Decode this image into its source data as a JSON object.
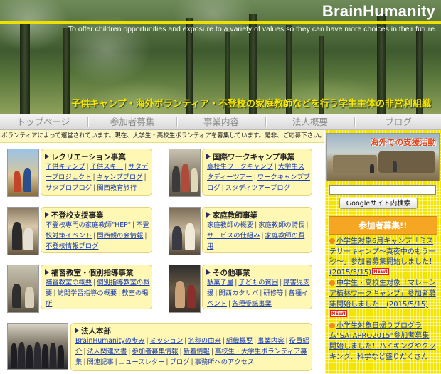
{
  "header": {
    "logo": "BrainHumanity",
    "tagline": "To offer children opportunities and exposure to a variety of values so they can have more choices in their future.",
    "headline": "子供キャンプ・海外ボランティア・不登校の家庭教師などを行う学生主体の非営利組織",
    "accent_color": "#f0e000"
  },
  "nav": [
    "トップページ",
    "参加者募集",
    "事業内容",
    "法人概要",
    "ブログ"
  ],
  "ticker": "ボランティアによって運営されています。現在、大学生・高校生ボランティアを募集しています。是非、ご応募下さい。",
  "cards": {
    "recreation": {
      "title": "レクリエーション事業",
      "links": [
        "子供キャンプ",
        "子供スキー",
        "サタデープロジェクト",
        "キャンプブログ",
        "サタプロブログ",
        "関西教育旅行"
      ]
    },
    "international": {
      "title": "国際ワークキャンプ事業",
      "links": [
        "高校生ワークキャンプ",
        "大学生スタディーツアー",
        "ワークキャンプブログ",
        "スタディツアーブログ"
      ]
    },
    "futoko": {
      "title": "不登校支援事業",
      "links": [
        "不登校専門の家庭教師\"HEP\"",
        "不登校対策イベント",
        "関西親の会情報",
        "不登校情報ブログ"
      ]
    },
    "tutor": {
      "title": "家庭教師事業",
      "links": [
        "家庭教師の概要",
        "家庭教師の特長",
        "サービスの仕組み",
        "家庭教師の費用"
      ]
    },
    "hoshu": {
      "title": "補習教室・個別指導事業",
      "links": [
        "補習教室の概要",
        "個別指導教室の概要",
        "訪問学習指導の概要",
        "教室の場所"
      ]
    },
    "other": {
      "title": "その他事業",
      "links": [
        "駄菓子屋",
        "子どもの貧困",
        "障害児支援",
        "関西カタリバ",
        "研修等",
        "各種イベント",
        "各種受託事業"
      ]
    },
    "hq": {
      "title": "法人本部",
      "links": [
        "BrainHumanityの歩み",
        "ミッション",
        "名称の由来",
        "組織概要",
        "事業内容",
        "役員紹介",
        "法人関連文書",
        "参加者募集情報",
        "新着情報",
        "高校生・大学生ボランティア募集",
        "関連記事",
        "ニュースレター",
        "ブログ",
        "事務所へのアクセス"
      ]
    }
  },
  "sidebar": {
    "support_banner": "海外での支援活動",
    "search_button": "Googleサイト内検索",
    "recruit_title": "参加者募集!!",
    "new_badge": "NEW!",
    "news": [
      {
        "text": "小学生対象6月キャンプ「ミステリーキャンプ〜真夜中のもう一秒〜」参加者募集開始しました！(2015/5/15)",
        "new": true
      },
      {
        "text": "中学生・高校生対象「マレーシア植林ワークキャンプ」参加者募集開始しました！(2015/5/15)",
        "new": true
      },
      {
        "text": "小学生対象日帰りプログラム\"SATAPRO2015\"参加者募集開始しました！ハイキングやクッキング、科学など盛りだくさん",
        "new": false
      }
    ]
  }
}
